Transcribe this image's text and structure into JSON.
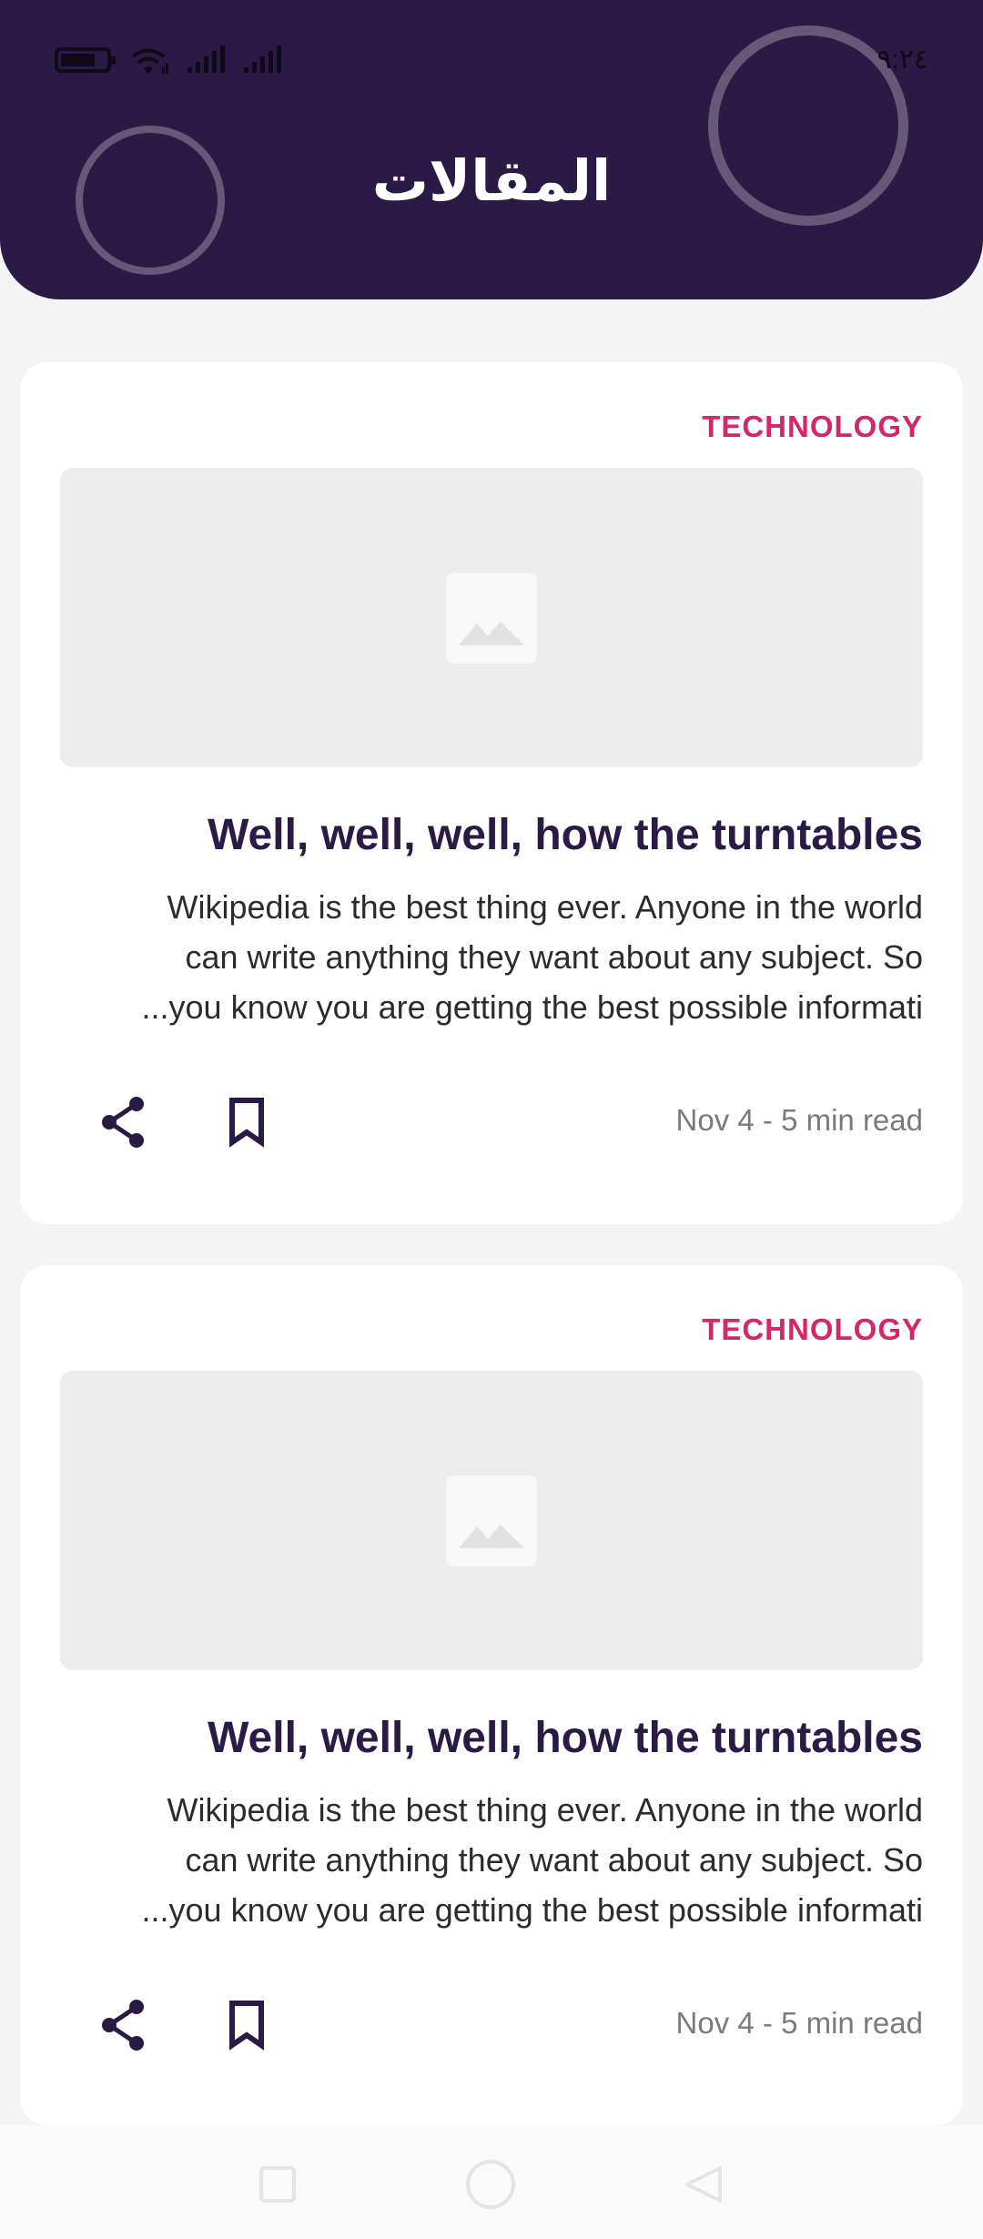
{
  "status_bar": {
    "time": "٩:٢٤",
    "battery_level": 0.8
  },
  "header": {
    "title": "المقالات",
    "background_color": "#2b1a45"
  },
  "articles": [
    {
      "category": "TECHNOLOGY",
      "title": "Well, well, well, how the turntables",
      "excerpt_lines": [
        "Wikipedia is the best thing ever. Anyone in the world",
        "can write anything they want about any subject. So",
        "...you know you are getting the best possible informati"
      ],
      "meta": "Nov 4 - 5 min read",
      "image_icon": "image-placeholder-icon",
      "share_icon": "share-icon",
      "bookmark_icon": "bookmark-icon"
    },
    {
      "category": "TECHNOLOGY",
      "title": "Well, well, well, how the turntables",
      "excerpt_lines": [
        "Wikipedia is the best thing ever. Anyone in the world",
        "can write anything they want about any subject. So",
        "...you know you are getting the best possible informati"
      ],
      "meta": "Nov 4 - 5 min read",
      "image_icon": "image-placeholder-icon",
      "share_icon": "share-icon",
      "bookmark_icon": "bookmark-icon"
    }
  ],
  "colors": {
    "accent": "#d4266a",
    "title_text": "#2b1a45",
    "meta_text": "#7a7a7a"
  },
  "navigation_bar": {
    "icons": [
      "recent-apps-icon",
      "home-icon",
      "back-icon"
    ]
  }
}
